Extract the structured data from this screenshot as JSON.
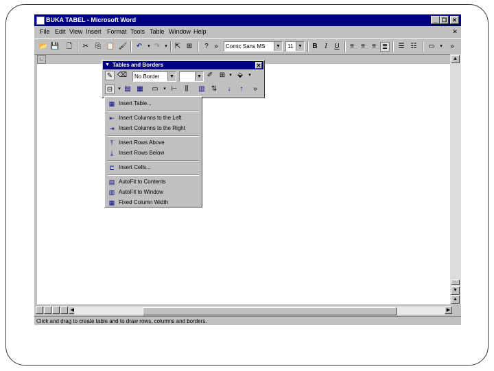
{
  "window": {
    "title": "BUKA TABEL - Microsoft Word",
    "minimize_glyph": "_",
    "restore_glyph": "❐",
    "close_glyph": "✕"
  },
  "menubar": {
    "items": [
      "File",
      "Edit",
      "View",
      "Insert",
      "Format",
      "Tools",
      "Table",
      "Window",
      "Help"
    ],
    "doc_close_glyph": "✕"
  },
  "toolbar": {
    "font": "Comic Sans MS",
    "size": "11",
    "overflow_glyph": "»"
  },
  "tables_borders": {
    "title": "Tables and Borders",
    "border_style": "No Border",
    "overflow_glyph": "»"
  },
  "insert_table_menu": {
    "items": [
      "Insert Table...",
      "Insert Columns to the Left",
      "Insert Columns to the Right",
      "Insert Rows Above",
      "Insert Rows Below",
      "Insert Cells...",
      "AutoFit to Contents",
      "AutoFit to Window",
      "Fixed Column Width"
    ]
  },
  "statusbar": {
    "text": "Click and drag to create table and to draw rows, columns and borders."
  }
}
